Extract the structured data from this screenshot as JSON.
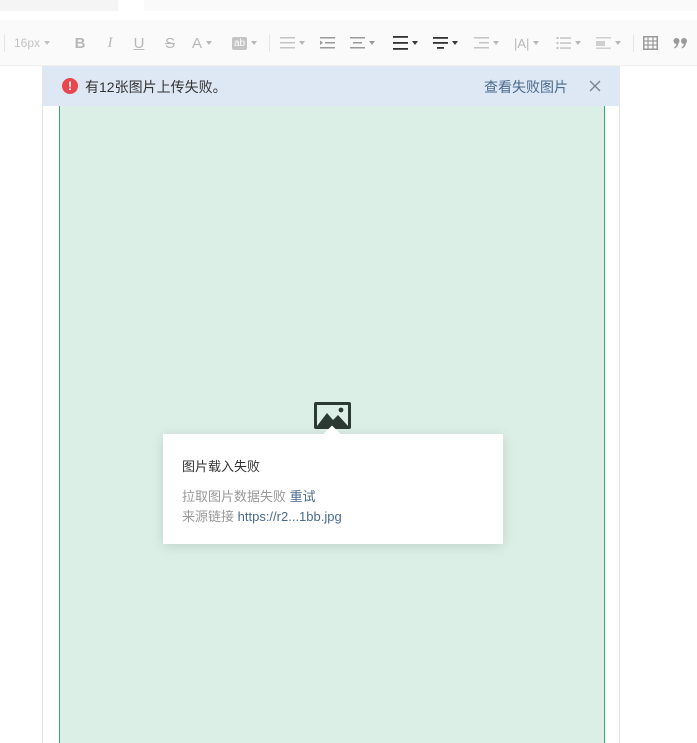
{
  "toolbar": {
    "font_size": "16px",
    "bold_label": "B",
    "italic_label": "I",
    "underline_label": "U",
    "strike_label": "S",
    "font_color_label": "A",
    "highlight_label": "ab",
    "letter_spacing_label": "|A|"
  },
  "banner": {
    "message": "有12张图片上传失败。",
    "view_failed_label": "查看失败图片",
    "error_mark": "!"
  },
  "popup": {
    "title": "图片载入失败",
    "fetch_failed_label": "拉取图片数据失败",
    "retry_label": "重试",
    "source_label": "来源链接",
    "source_url": "https://r2...1bb.jpg"
  },
  "colors": {
    "banner_bg": "#dde8f4",
    "error_red": "#e8474d",
    "link_blue": "#4b6a8e",
    "image_placeholder_bg": "#dbefe7",
    "image_border_green": "#3aa57a"
  }
}
